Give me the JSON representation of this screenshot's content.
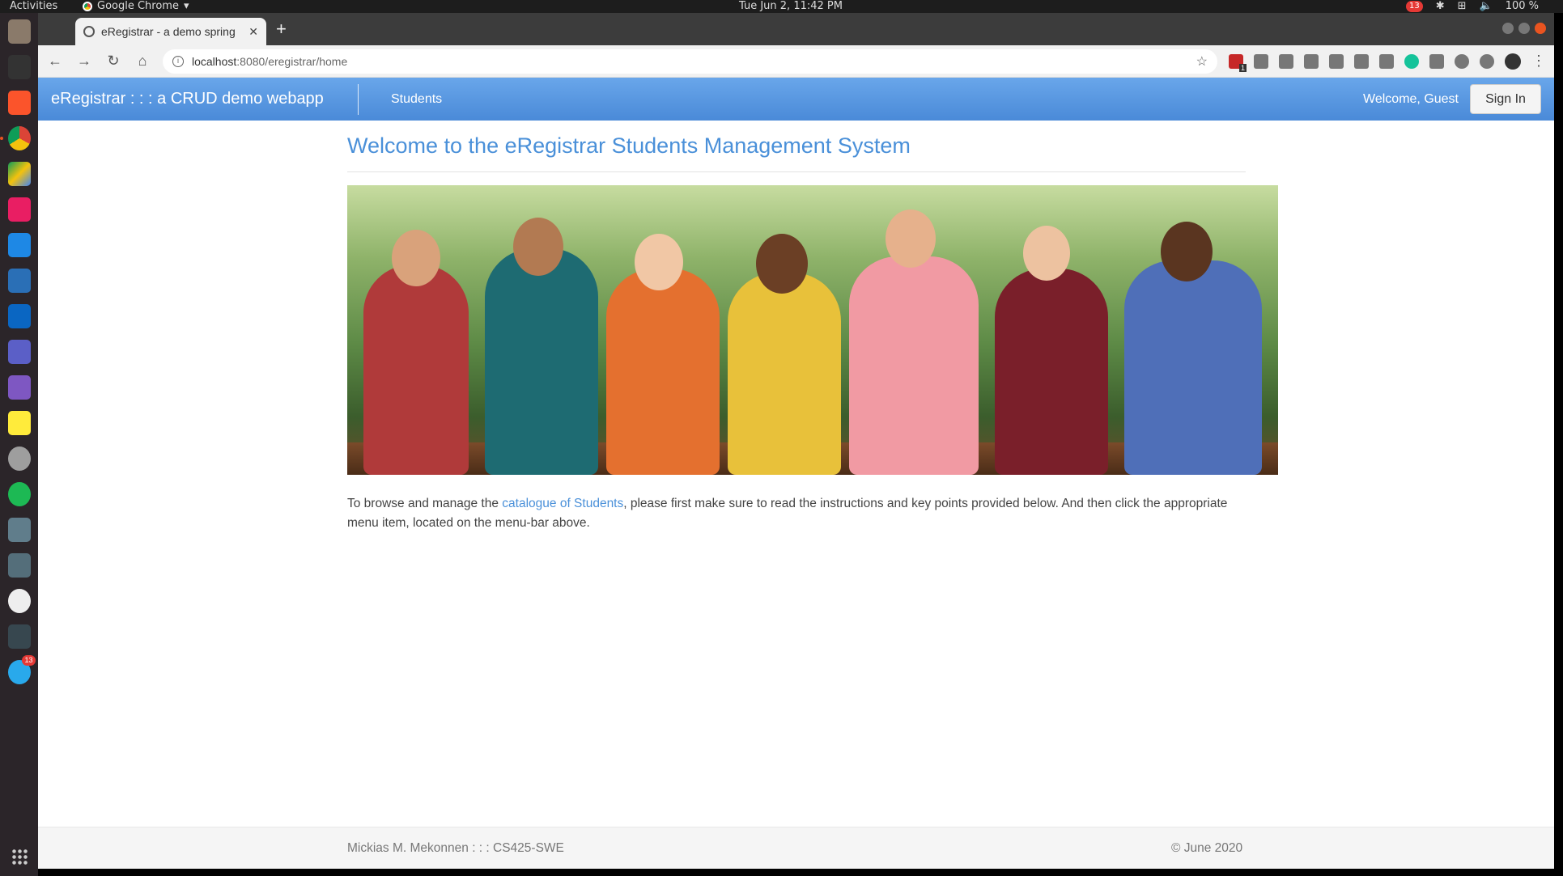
{
  "system": {
    "activities": "Activities",
    "app_menu": "Google Chrome",
    "clock": "Tue Jun  2, 11:42 PM",
    "notif_count": "13",
    "battery": "100 %"
  },
  "dock": {
    "telegram_badge": "13"
  },
  "browser": {
    "tab_title": "eRegistrar - a demo spring",
    "url_host": "localhost",
    "url_path": ":8080/eregistrar/home",
    "ext_badge": "1"
  },
  "navbar": {
    "brand": "eRegistrar : : : a CRUD demo webapp",
    "students": "Students",
    "welcome": "Welcome, Guest",
    "signin": "Sign In"
  },
  "main": {
    "heading": "Welcome to the eRegistrar Students Management System",
    "intro_before": "To browse and manage the ",
    "intro_link": "catalogue of Students",
    "intro_after": ", please first make sure to read the instructions and key points provided below. And then click the appropriate menu item, located on the menu-bar above."
  },
  "footer": {
    "left": "Mickias M. Mekonnen : : : CS425-SWE",
    "right": "© June 2020"
  },
  "colors": {
    "navbar": "#4a8ad8",
    "heading": "#4a90d9",
    "link": "#4a90d9"
  }
}
